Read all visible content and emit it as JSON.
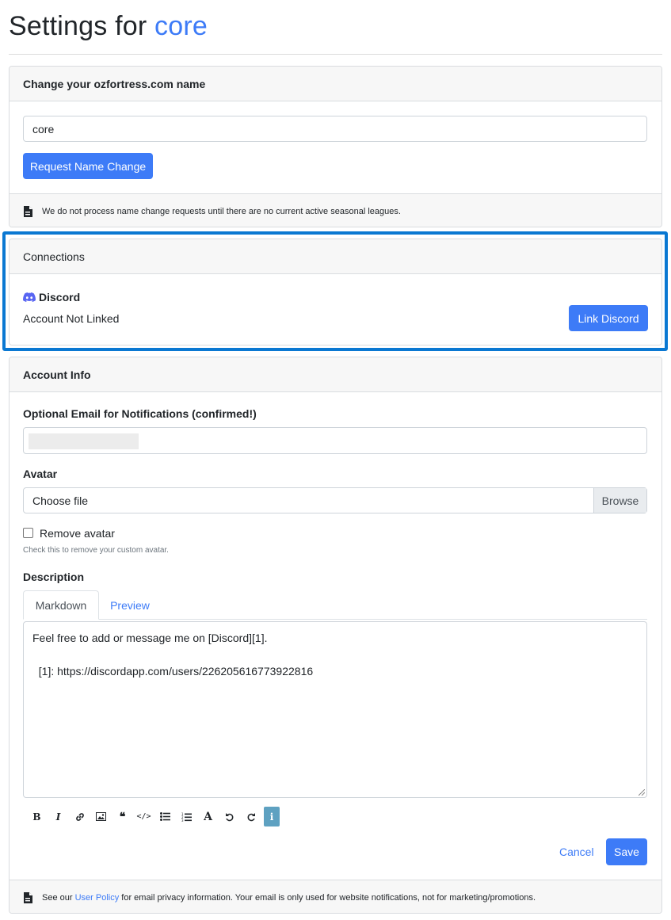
{
  "title": {
    "prefix": "Settings for",
    "username": "core"
  },
  "name_card": {
    "header": "Change your ozfortress.com name",
    "name_value": "core",
    "request_button": "Request Name Change",
    "footer_note": "We do not process name change requests until there are no current active seasonal leagues."
  },
  "connections": {
    "header": "Connections",
    "discord_label": "Discord",
    "status": "Account Not Linked",
    "link_button": "Link Discord"
  },
  "account_info": {
    "header": "Account Info",
    "email_label": "Optional Email for Notifications (confirmed!)",
    "email_value": "",
    "avatar_label": "Avatar",
    "file_placeholder": "Choose file",
    "browse_label": "Browse",
    "remove_avatar_label": "Remove avatar",
    "remove_avatar_help": "Check this to remove your custom avatar.",
    "description_label": "Description",
    "tabs": [
      "Markdown",
      "Preview"
    ],
    "description_line1": "Feel free to add or message me on [Discord][1].",
    "description_line2": "  [1]: https://discordapp.com/users/226205616773922816",
    "toolbar_icons": [
      "bold-icon",
      "italic-icon",
      "link-icon",
      "image-icon",
      "quote-icon",
      "code-icon",
      "bullet-list-icon",
      "numbered-list-icon",
      "heading-icon",
      "undo-icon",
      "redo-icon",
      "info-icon"
    ],
    "cancel_label": "Cancel",
    "save_label": "Save",
    "footer_prefix": "See our",
    "footer_link": "User Policy",
    "footer_suffix": "for email privacy information. Your email is only used for website notifications, not for marketing/promotions."
  },
  "colors": {
    "accent": "#3d7bf7",
    "highlight_border": "#0a78d2",
    "discord": "#5865F2",
    "info_button": "#5ea1c1"
  }
}
